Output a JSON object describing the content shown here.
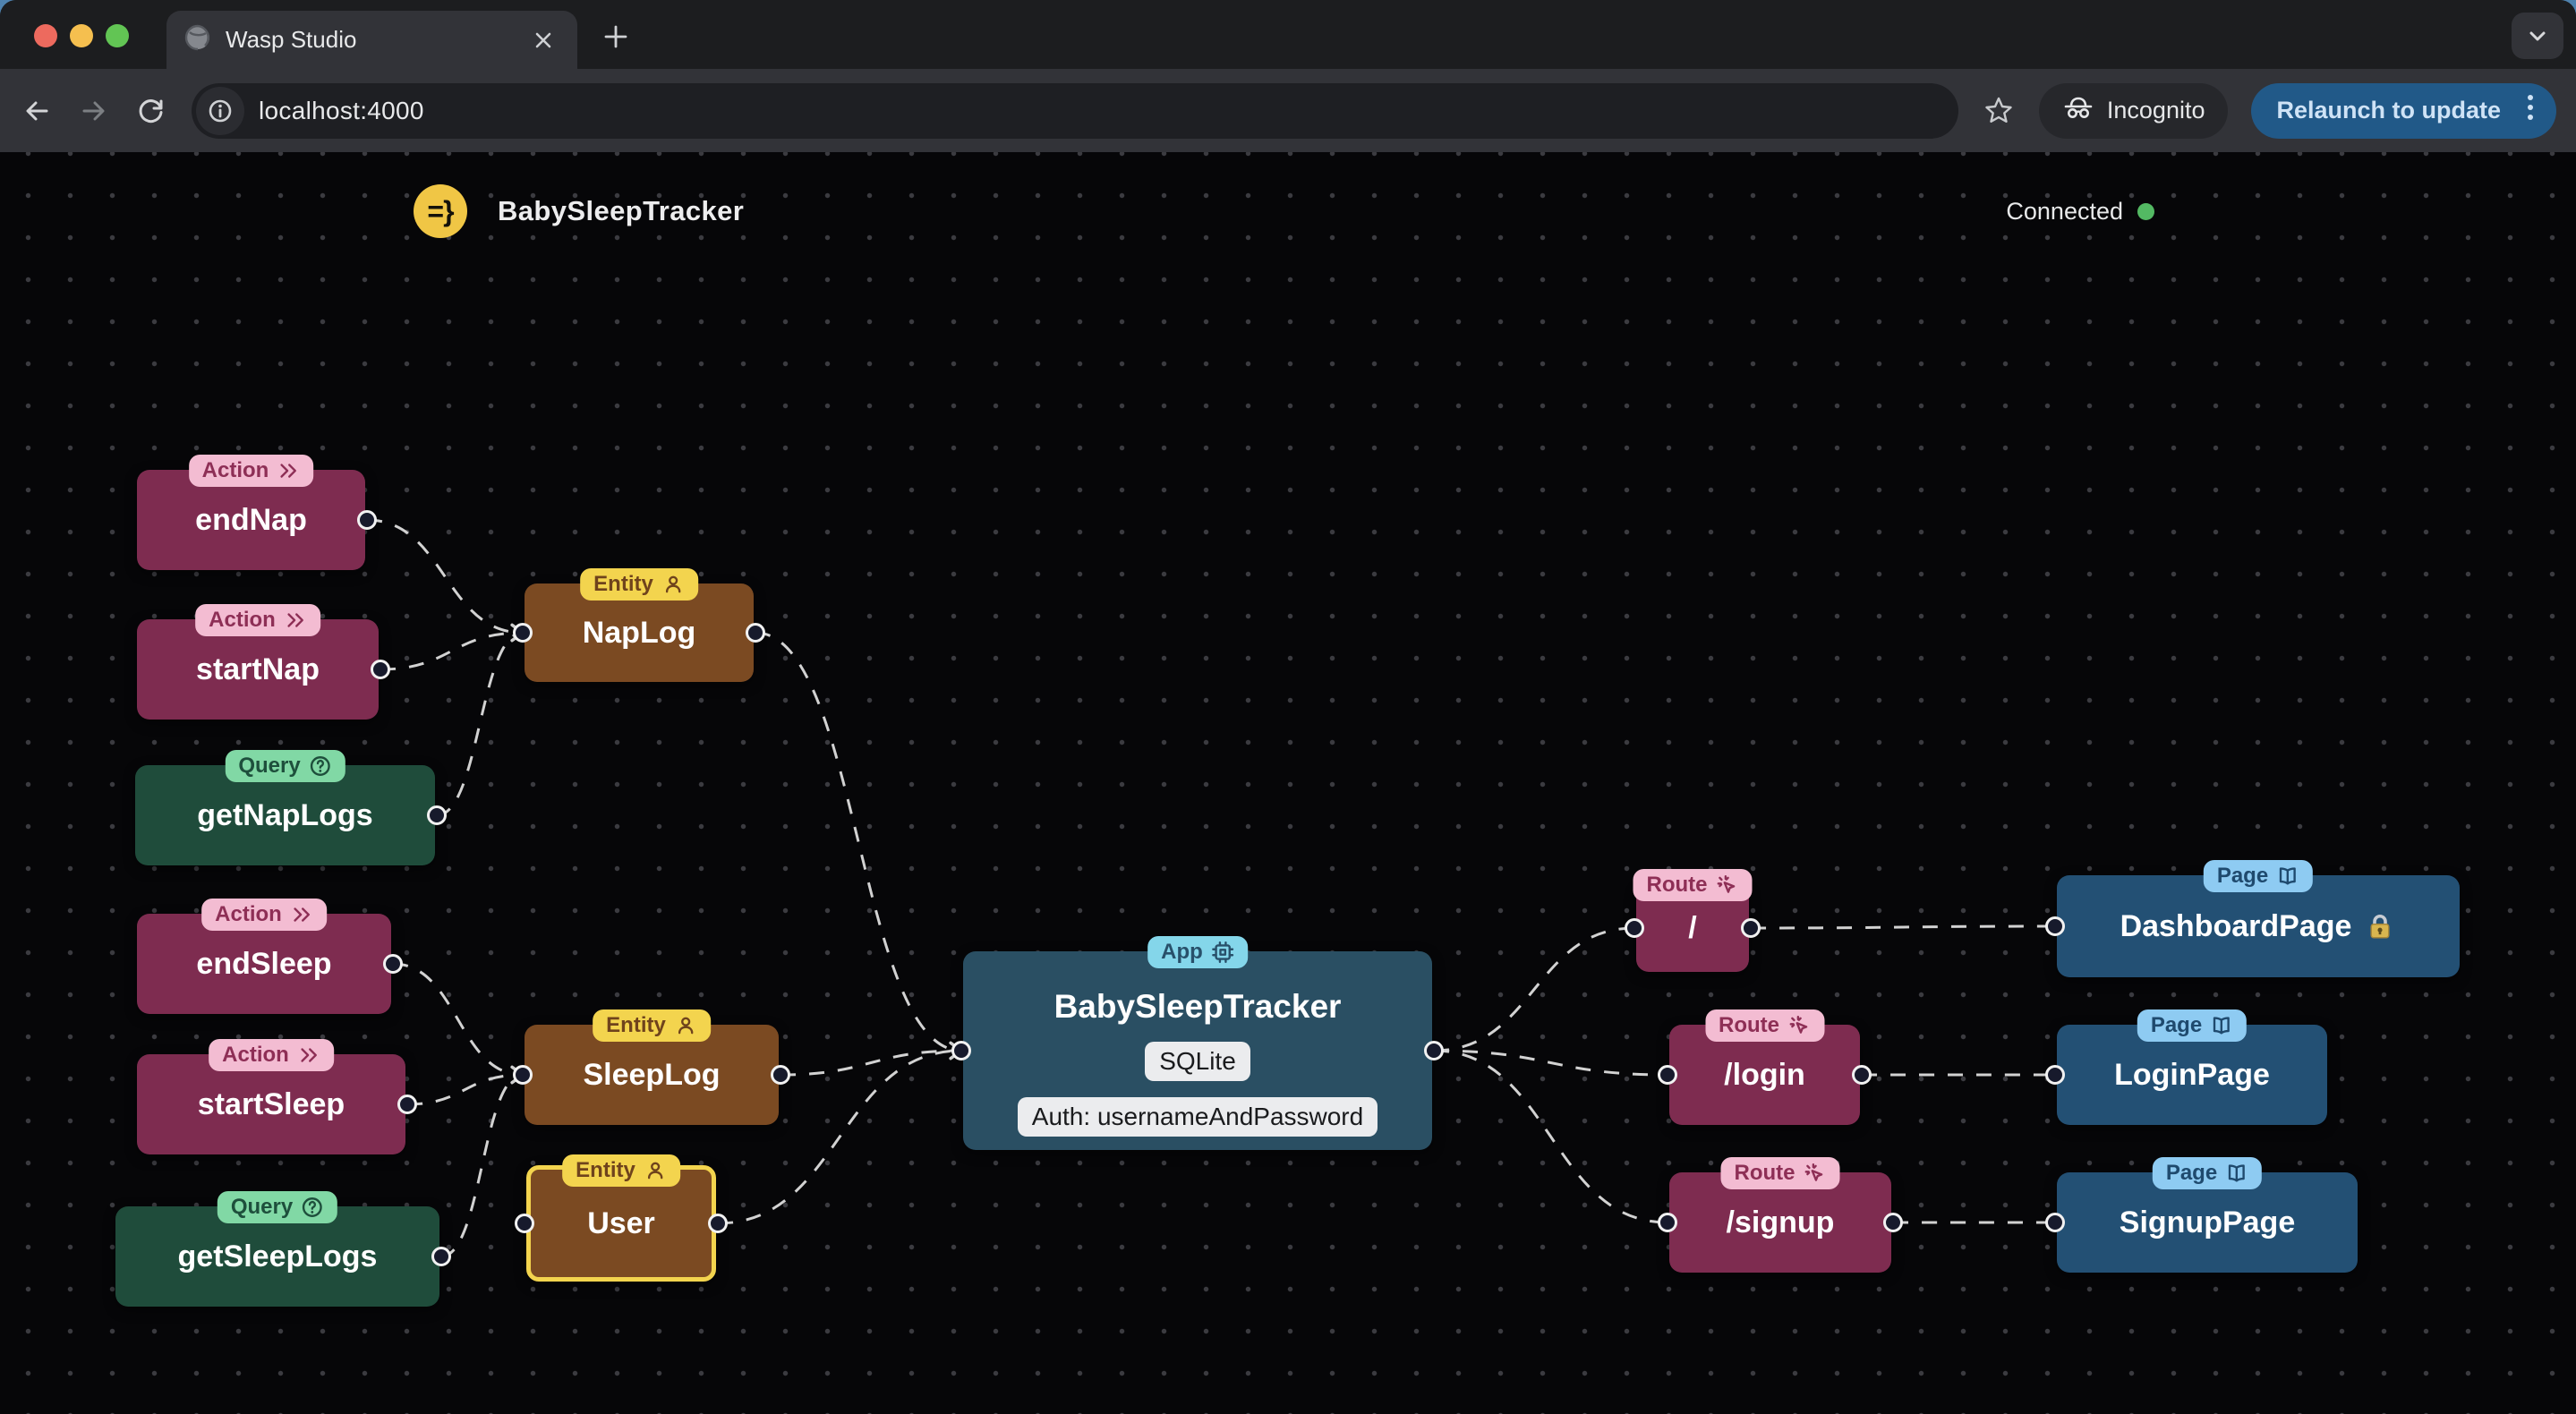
{
  "browser": {
    "tab_title": "Wasp Studio",
    "url": "localhost:4000",
    "incognito_label": "Incognito",
    "relaunch_label": "Relaunch to update"
  },
  "header": {
    "logo_text": "=}",
    "app_title": "BabySleepTracker",
    "status": "Connected"
  },
  "palette": {
    "action": {
      "bg": "#7e2c50",
      "badge_bg": "#f3bcd2",
      "badge_fg": "#8e2f56"
    },
    "query": {
      "bg": "#1f4c3b",
      "badge_bg": "#81d8a5",
      "badge_fg": "#1e4f3c"
    },
    "entity": {
      "bg": "#7b4a22",
      "badge_bg": "#f3d44e",
      "badge_fg": "#6f431c"
    },
    "app": {
      "bg": "#2a4f63",
      "badge_bg": "#84d6ea",
      "badge_fg": "#28506a"
    },
    "route": {
      "bg": "#7e2c50",
      "badge_bg": "#f3bcd2",
      "badge_fg": "#8e2f56"
    },
    "page": {
      "bg": "#235074",
      "badge_bg": "#8ecbf2",
      "badge_fg": "#1f4a6e"
    },
    "edge": "#d2d2d2",
    "handle_fill": "#171a2c",
    "handle_ring": "#f1f1f1",
    "highlight_border": "#f3d44e",
    "connected_dot": "#53b963",
    "logo_bg": "#f0c645",
    "relaunch_bg": "#215988"
  },
  "canvas": {
    "nodes": [
      {
        "id": "endNap",
        "kind": "action",
        "badge": "Action",
        "icon": "chevrons-right-icon",
        "label": "endNap"
      },
      {
        "id": "startNap",
        "kind": "action",
        "badge": "Action",
        "icon": "chevrons-right-icon",
        "label": "startNap"
      },
      {
        "id": "getNapLogs",
        "kind": "query",
        "badge": "Query",
        "icon": "help-circle-icon",
        "label": "getNapLogs"
      },
      {
        "id": "napLog",
        "kind": "entity",
        "badge": "Entity",
        "icon": "user-icon",
        "label": "NapLog"
      },
      {
        "id": "endSleep",
        "kind": "action",
        "badge": "Action",
        "icon": "chevrons-right-icon",
        "label": "endSleep"
      },
      {
        "id": "startSleep",
        "kind": "action",
        "badge": "Action",
        "icon": "chevrons-right-icon",
        "label": "startSleep"
      },
      {
        "id": "getSleepLogs",
        "kind": "query",
        "badge": "Query",
        "icon": "help-circle-icon",
        "label": "getSleepLogs"
      },
      {
        "id": "sleepLog",
        "kind": "entity",
        "badge": "Entity",
        "icon": "user-icon",
        "label": "SleepLog"
      },
      {
        "id": "user",
        "kind": "entity",
        "badge": "Entity",
        "icon": "user-icon",
        "label": "User",
        "highlighted": true
      },
      {
        "id": "app",
        "kind": "app",
        "badge": "App",
        "icon": "cpu-icon",
        "label": "BabySleepTracker",
        "pills": [
          "SQLite",
          "Auth: usernameAndPassword"
        ]
      },
      {
        "id": "routeRoot",
        "kind": "route",
        "badge": "Route",
        "icon": "pointer-click-icon",
        "label": "/"
      },
      {
        "id": "routeLogin",
        "kind": "route",
        "badge": "Route",
        "icon": "pointer-click-icon",
        "label": "/login"
      },
      {
        "id": "routeSignup",
        "kind": "route",
        "badge": "Route",
        "icon": "pointer-click-icon",
        "label": "/signup"
      },
      {
        "id": "dashboardPage",
        "kind": "page",
        "badge": "Page",
        "icon": "book-open-icon",
        "label": "DashboardPage",
        "locked": true
      },
      {
        "id": "loginPage",
        "kind": "page",
        "badge": "Page",
        "icon": "book-open-icon",
        "label": "LoginPage"
      },
      {
        "id": "signupPage",
        "kind": "page",
        "badge": "Page",
        "icon": "book-open-icon",
        "label": "SignupPage"
      }
    ],
    "edges": [
      {
        "from": "endNap",
        "to": "napLog"
      },
      {
        "from": "startNap",
        "to": "napLog"
      },
      {
        "from": "getNapLogs",
        "to": "napLog"
      },
      {
        "from": "endSleep",
        "to": "sleepLog"
      },
      {
        "from": "startSleep",
        "to": "sleepLog"
      },
      {
        "from": "getSleepLogs",
        "to": "sleepLog"
      },
      {
        "from": "napLog",
        "to": "app"
      },
      {
        "from": "sleepLog",
        "to": "app"
      },
      {
        "from": "user",
        "to": "app"
      },
      {
        "from": "app",
        "to": "routeRoot"
      },
      {
        "from": "app",
        "to": "routeLogin"
      },
      {
        "from": "app",
        "to": "routeSignup"
      },
      {
        "from": "routeRoot",
        "to": "dashboardPage"
      },
      {
        "from": "routeLogin",
        "to": "loginPage"
      },
      {
        "from": "routeSignup",
        "to": "signupPage"
      }
    ]
  }
}
